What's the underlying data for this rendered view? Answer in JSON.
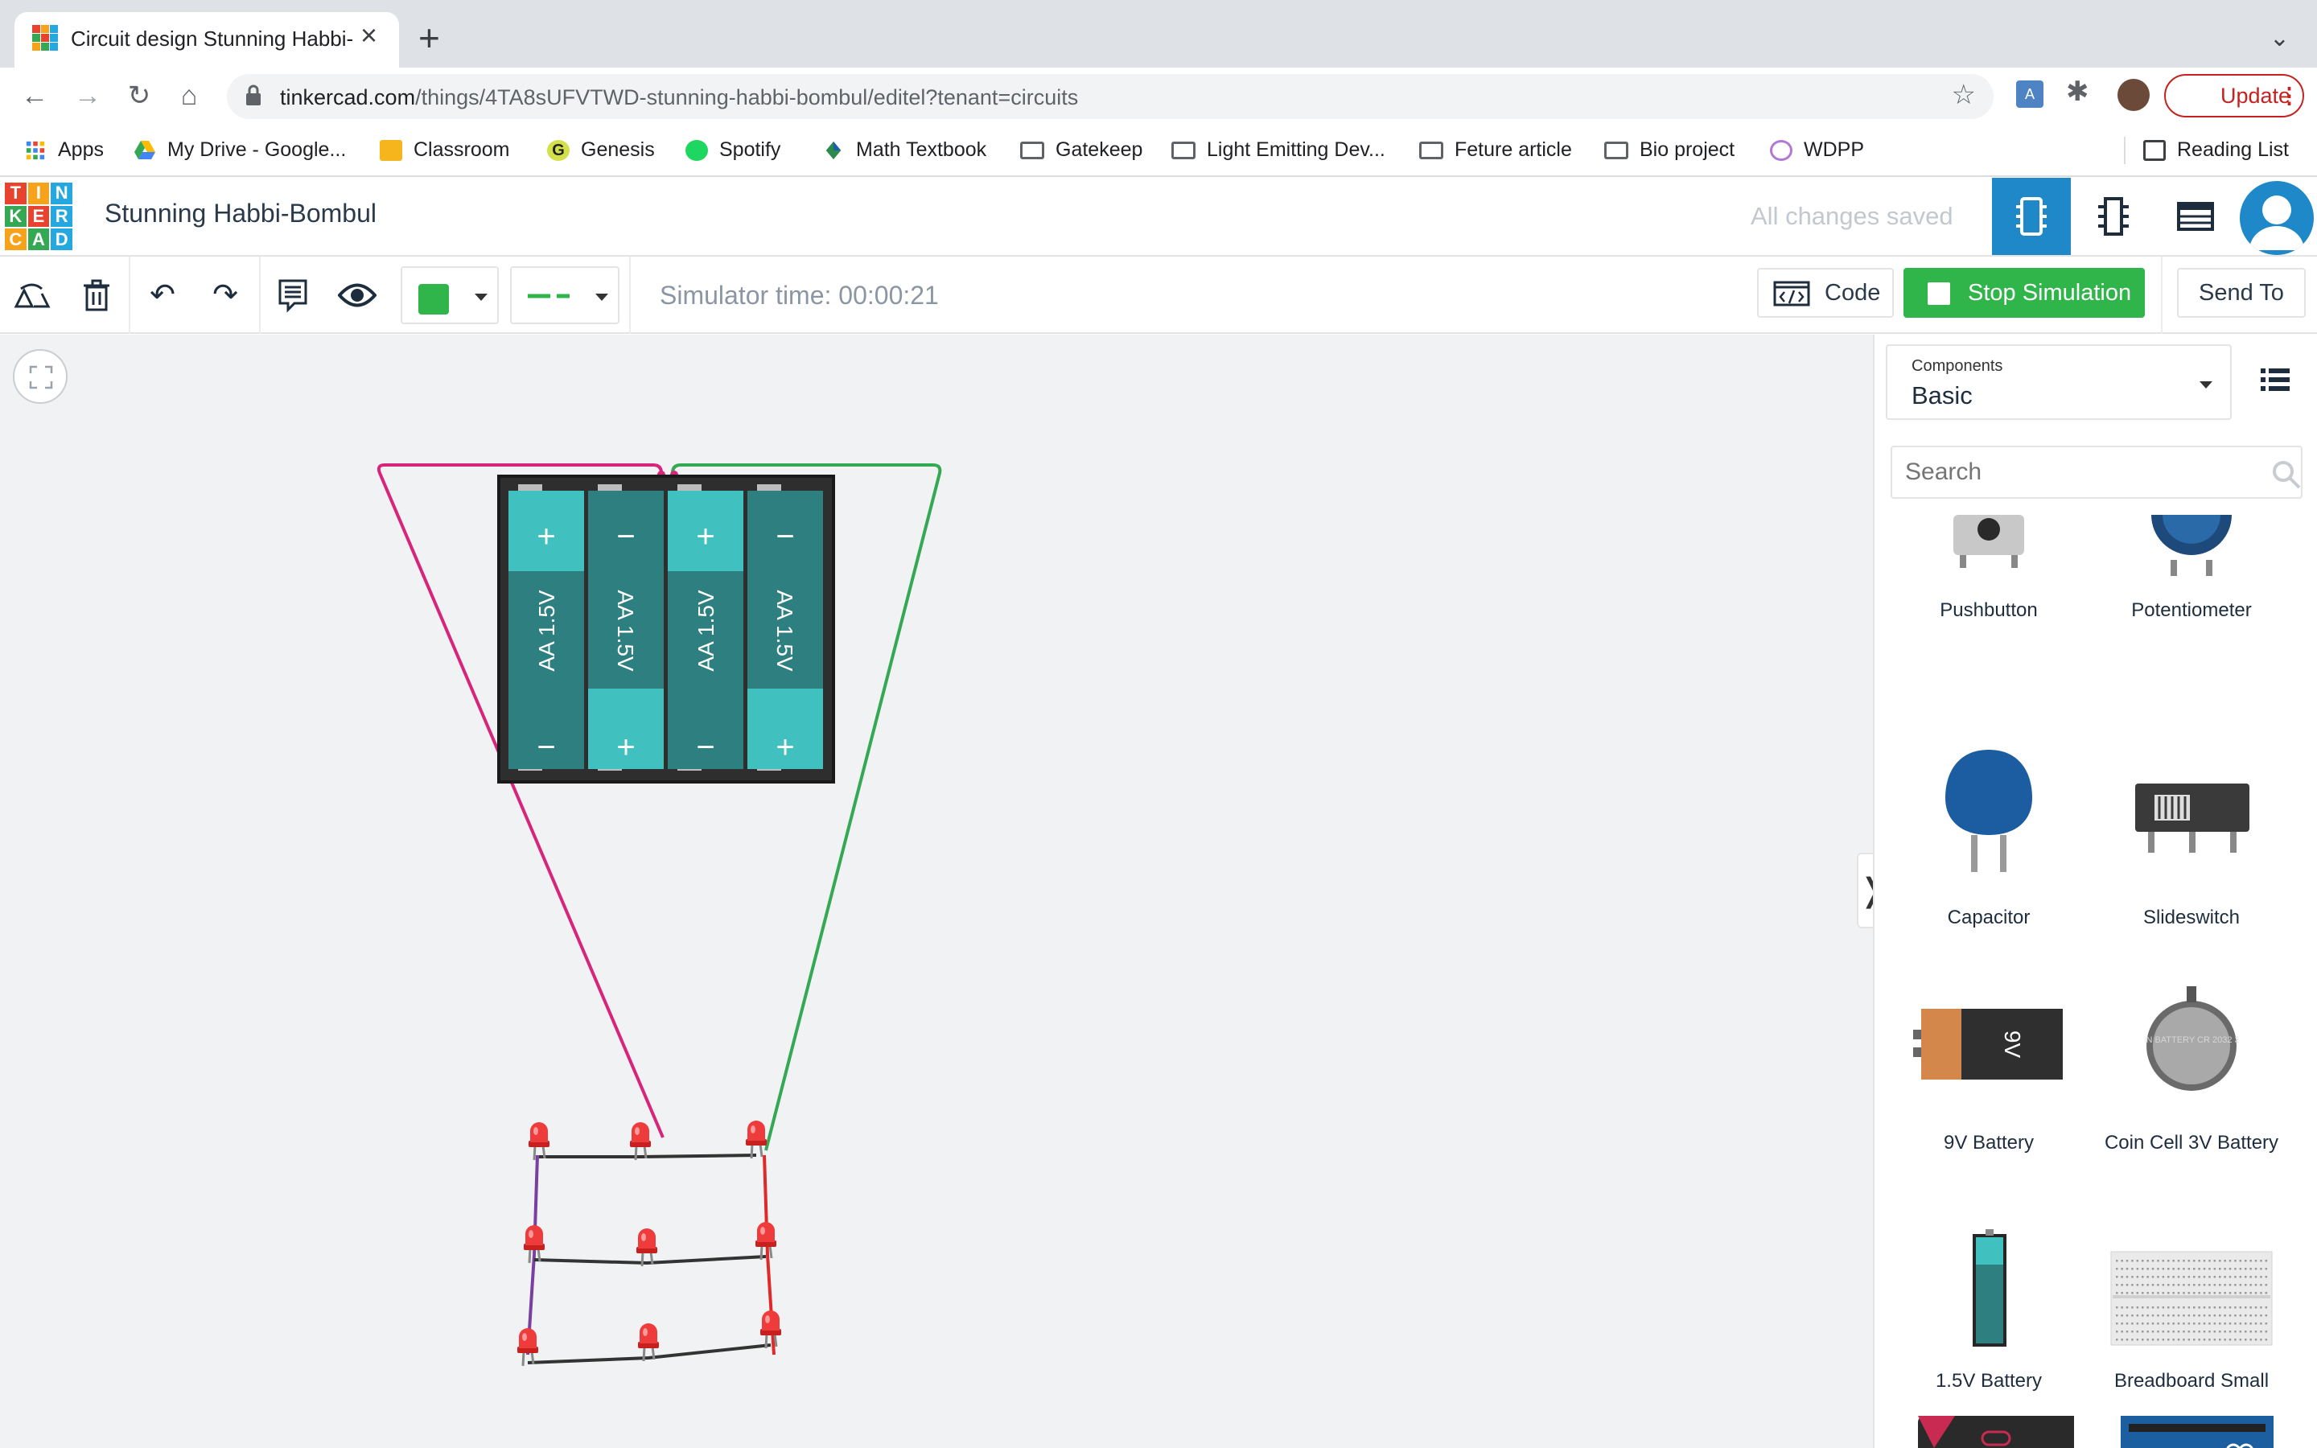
{
  "browser": {
    "tab_title": "Circuit design Stunning Habbi-",
    "url_host": "tinkercad.com",
    "url_path": "/things/4TA8sUFVTWD-stunning-habbi-bombul/editel?tenant=circuits",
    "update_label": "Update",
    "bookmarks": [
      "Apps",
      "My Drive - Google...",
      "Classroom",
      "Genesis",
      "Spotify",
      "Math Textbook",
      "Gatekeep",
      "Light Emitting Dev...",
      "Feture article",
      "Bio project",
      "WDPP"
    ],
    "reading_list": "Reading List"
  },
  "app": {
    "logo_letters": [
      "T",
      "I",
      "N",
      "K",
      "E",
      "R",
      "C",
      "A",
      "D"
    ],
    "logo_colors": [
      "#e8432e",
      "#f6a21a",
      "#25a8e0",
      "#35a853",
      "#e8432e",
      "#25a8e0",
      "#f6a21a",
      "#35a853",
      "#25a8e0"
    ],
    "design_title": "Stunning Habbi-Bombul",
    "save_status": "All changes saved"
  },
  "toolbar": {
    "sim_time": "Simulator time: 00:00:21",
    "code_label": "Code",
    "stop_label": "Stop Simulation",
    "sendto_label": "Send To",
    "wire_color": "#2fb54a"
  },
  "canvas": {
    "battery_cells": [
      {
        "label": "AA 1.5V",
        "top": "+",
        "bottom": "−"
      },
      {
        "label": "AA 1.5V",
        "top": "−",
        "bottom": "+"
      },
      {
        "label": "AA 1.5V",
        "top": "+",
        "bottom": "−"
      },
      {
        "label": "AA 1.5V",
        "top": "−",
        "bottom": "+"
      }
    ]
  },
  "panel": {
    "components_label": "Components",
    "components_value": "Basic",
    "search_placeholder": "Search",
    "items": [
      "Pushbutton",
      "Potentiometer",
      "Capacitor",
      "Slideswitch",
      "9V Battery",
      "Coin Cell 3V Battery",
      "1.5V Battery",
      "Breadboard Small"
    ],
    "nine_volt_label": "9V",
    "coin_cell_text": "COIN BATTERY CR 2032 3.0V"
  }
}
